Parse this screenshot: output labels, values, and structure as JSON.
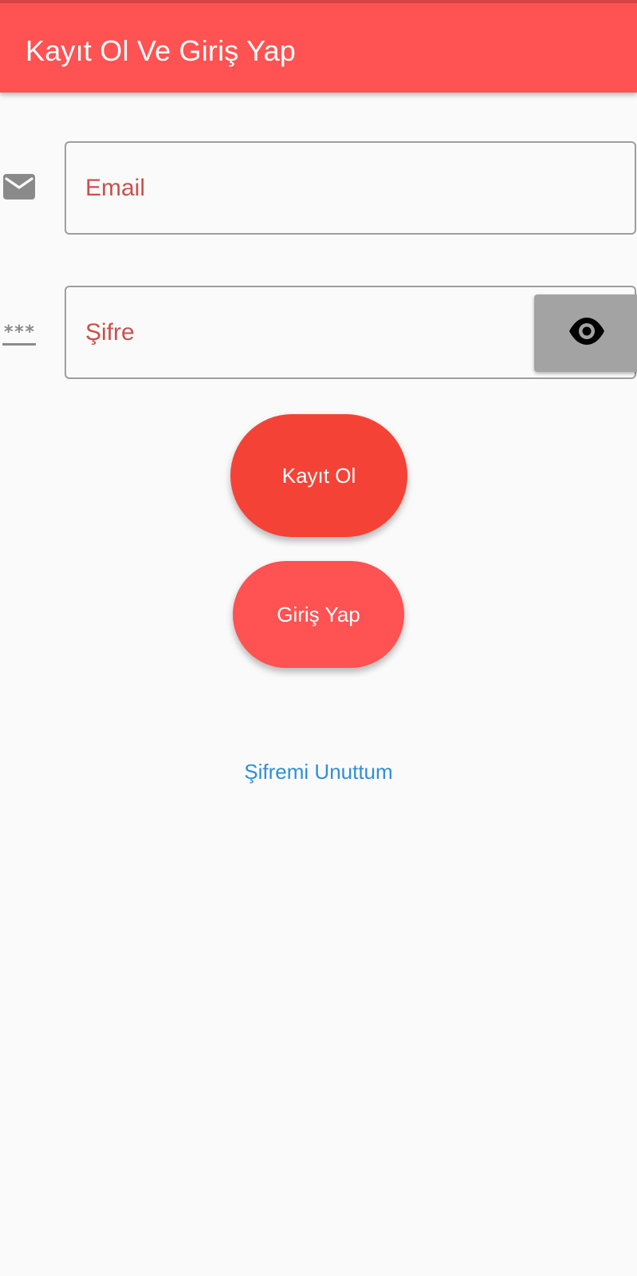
{
  "app_bar": {
    "title": "Kayıt Ol Ve Giriş Yap",
    "color": "#ff5252"
  },
  "form": {
    "email": {
      "icon": "mail-icon",
      "placeholder": "Email",
      "value": ""
    },
    "password": {
      "icon": "password-icon",
      "placeholder": "Şifre",
      "value": "",
      "toggle_icon": "eye-icon"
    }
  },
  "buttons": {
    "register_label": "Kayıt Ol",
    "login_label": "Giriş Yap",
    "register_color": "#f44336",
    "login_color": "#ff5252"
  },
  "links": {
    "forgot_password": "Şifremi Unuttum",
    "color": "#2f8fd8"
  }
}
